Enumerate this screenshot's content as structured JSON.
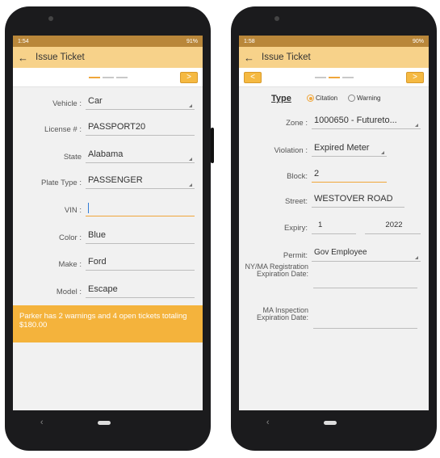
{
  "left": {
    "status": {
      "time": "1:54",
      "right": "91%"
    },
    "appbar": {
      "back": "←",
      "title": "Issue Ticket"
    },
    "pager": {
      "next": ">"
    },
    "fields": [
      {
        "label": "Vehicle :",
        "value": "Car",
        "dropdown": true
      },
      {
        "label": "License # :",
        "value": "PASSPORT20",
        "dropdown": false
      },
      {
        "label": "State",
        "value": "Alabama",
        "dropdown": true
      },
      {
        "label": "Plate Type :",
        "value": "PASSENGER",
        "dropdown": true
      },
      {
        "label": "VIN :",
        "value": "",
        "dropdown": false,
        "focused": true
      },
      {
        "label": "Color :",
        "value": "Blue",
        "dropdown": false
      },
      {
        "label": "Make :",
        "value": "Ford",
        "dropdown": false
      },
      {
        "label": "Model :",
        "value": "Escape",
        "dropdown": false
      }
    ],
    "banner": "Parker has 2 warnings and 4 open tickets totaling $180.00"
  },
  "right": {
    "status": {
      "time": "1:58",
      "right": "90%"
    },
    "appbar": {
      "back": "←",
      "title": "Issue Ticket"
    },
    "pager": {
      "prev": "<",
      "next": ">"
    },
    "type": {
      "label": "Type",
      "option1": "Citation",
      "option2": "Warning"
    },
    "fields": {
      "zone": {
        "label": "Zone :",
        "value": "1000650 - Futureto..."
      },
      "violation": {
        "label": "Violation :",
        "value": "Expired  Meter"
      },
      "block": {
        "label": "Block:",
        "value": "2"
      },
      "street": {
        "label": "Street:",
        "value": "WESTOVER ROAD"
      },
      "expiry": {
        "label": "Expiry:",
        "month": "1",
        "year": "2022"
      },
      "permit": {
        "label": "Permit:",
        "value": "Gov Employee"
      },
      "nyma": {
        "label": "NY/MA Registration Expiration Date:"
      },
      "ma": {
        "label": "MA Inspection Expiration Date:"
      }
    }
  },
  "nav": {
    "back": "‹"
  },
  "colors": {
    "accent": "#f0a63a",
    "appbar": "#f7d28a",
    "banner": "#f4b33c"
  }
}
